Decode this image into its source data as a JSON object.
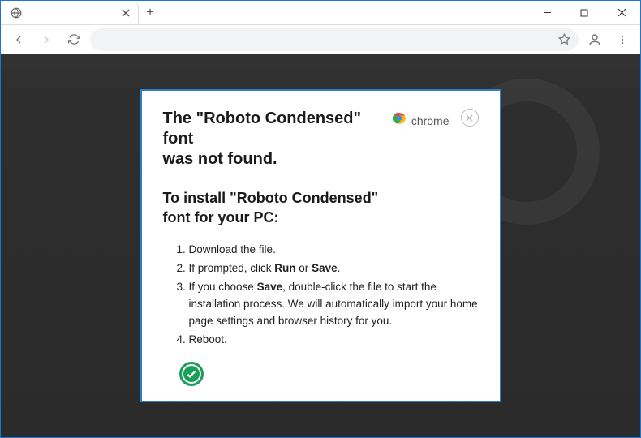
{
  "browser": {
    "tab": {
      "title": ""
    },
    "omnibox": {
      "value": ""
    }
  },
  "popup": {
    "title_line1": "The \"Roboto Condensed\" font",
    "title_line2": "was not found.",
    "chrome_label": "chrome",
    "subtitle_line1": "To install \"Roboto Condensed\"",
    "subtitle_line2": "font for your PC:",
    "steps": {
      "s1": "Download the file.",
      "s2_pre": "If prompted, click ",
      "s2_run": "Run",
      "s2_or": " or ",
      "s2_save": "Save",
      "s2_post": ".",
      "s3_pre": "If you choose ",
      "s3_save": "Save",
      "s3_post": ", double-click the file to start the installation process. We will automatically import your home page settings and browser history for you.",
      "s4": "Reboot."
    }
  }
}
